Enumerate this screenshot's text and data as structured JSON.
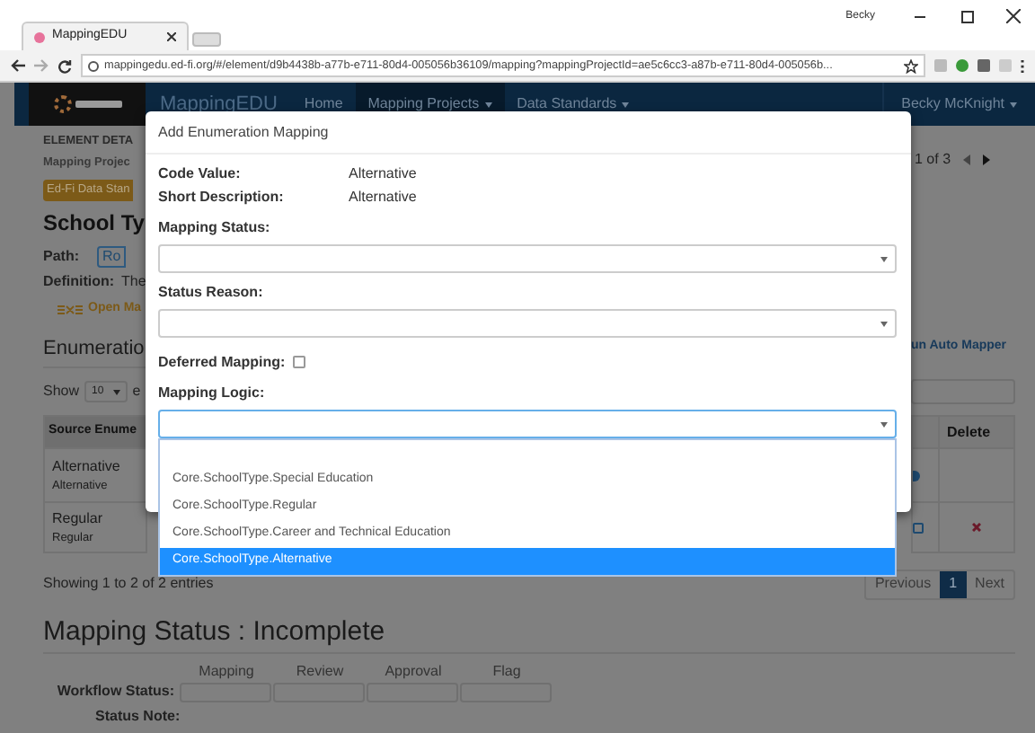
{
  "browser": {
    "tab_title": "MappingEDU",
    "url": "mappingedu.ed-fi.org/#/element/d9b4438b-a77b-e711-80d4-005056b36109/mapping?mappingProjectId=ae5c6cc3-a87b-e711-80d4-005056b...",
    "user": "Becky"
  },
  "navbar": {
    "brand": "MappingEDU",
    "items": [
      {
        "label": "Home",
        "selected": false,
        "dropdown": false
      },
      {
        "label": "Mapping Projects",
        "selected": true,
        "dropdown": true
      },
      {
        "label": "Data Standards",
        "selected": false,
        "dropdown": true
      }
    ],
    "user": "Becky McKnight"
  },
  "page": {
    "section_label": "ELEMENT DETA",
    "project": "Mapping Projec",
    "standard_badge": "Ed-Fi Data Stan",
    "title": "School Ty",
    "path_label": "Path:",
    "path_value": "Ro",
    "definition_label": "Definition:",
    "definition_value": "The",
    "open_link": "Open Ma",
    "pager": "1 of 3",
    "enumerations_heading": "Enumeratio",
    "show_label": "Show",
    "page_size": "10",
    "entries_fragment": "e",
    "auto_mapper_link": "un Auto Mapper",
    "table": {
      "columns": [
        "Source Enume",
        "Delete"
      ],
      "rows": [
        {
          "value": "Alternative",
          "description": "Alternative",
          "deletable": false
        },
        {
          "value": "Regular",
          "description": "Regular",
          "deletable": true
        }
      ]
    },
    "info": "Showing 1 to 2 of 2 entries",
    "pagination": [
      {
        "label": "Previous",
        "selected": false
      },
      {
        "label": "1",
        "selected": true
      },
      {
        "label": "Next",
        "selected": false
      }
    ],
    "mapping_status": {
      "heading": "Mapping Status : Incomplete",
      "columns": [
        "Mapping",
        "Review",
        "Approval",
        "Flag"
      ],
      "workflow_label": "Workflow Status:",
      "note_label": "Status Note:"
    }
  },
  "modal": {
    "title": "Add Enumeration Mapping",
    "fields": [
      {
        "kind": "text",
        "label": "Code Value:",
        "value": "Alternative"
      },
      {
        "kind": "text",
        "label": "Short Description:",
        "value": "Alternative"
      },
      {
        "kind": "select",
        "label": "Mapping Status:",
        "focused": false
      },
      {
        "kind": "select",
        "label": "Status Reason:",
        "focused": false
      },
      {
        "kind": "checkbox",
        "label": "Deferred Mapping:",
        "checked": false
      },
      {
        "kind": "select",
        "label": "Mapping Logic:",
        "focused": true
      }
    ],
    "dropdown_options": [
      {
        "label": "Core.SchoolType.Special Education",
        "selected": false
      },
      {
        "label": "Core.SchoolType.Regular",
        "selected": false
      },
      {
        "label": "Core.SchoolType.Career and Technical Education",
        "selected": false
      },
      {
        "label": "Core.SchoolType.Alternative",
        "selected": true
      }
    ]
  }
}
